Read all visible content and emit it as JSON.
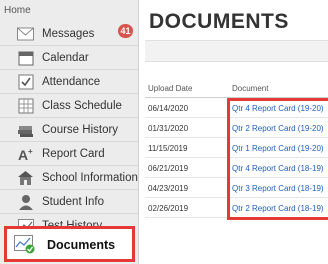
{
  "sidebar": {
    "home": "Home",
    "items": [
      {
        "label": "Messages",
        "icon": "envelope-icon",
        "badge": "41"
      },
      {
        "label": "Calendar",
        "icon": "calendar-icon"
      },
      {
        "label": "Attendance",
        "icon": "checkbox-icon"
      },
      {
        "label": "Class Schedule",
        "icon": "schedule-grid-icon"
      },
      {
        "label": "Course History",
        "icon": "books-icon"
      },
      {
        "label": "Report Card",
        "icon": "grade-a-plus-icon"
      },
      {
        "label": "School Information",
        "icon": "school-building-icon"
      },
      {
        "label": "Student Info",
        "icon": "student-person-icon"
      },
      {
        "label": "Test History",
        "icon": "chart-line-icon"
      }
    ],
    "active": {
      "label": "Documents",
      "icon": "documents-chart-check-icon"
    }
  },
  "main": {
    "title": "DOCUMENTS",
    "columns": {
      "date": "Upload Date",
      "document": "Document"
    },
    "rows": [
      {
        "date": "06/14/2020",
        "document": "Qtr 4 Report Card (19-20)"
      },
      {
        "date": "01/31/2020",
        "document": "Qtr 2 Report Card (19-20)"
      },
      {
        "date": "11/15/2019",
        "document": "Qtr 1 Report Card (19-20)"
      },
      {
        "date": "06/21/2019",
        "document": "Qtr 4 Report Card (18-19)"
      },
      {
        "date": "04/23/2019",
        "document": "Qtr 3 Report Card (18-19)"
      },
      {
        "date": "02/26/2019",
        "document": "Qtr 2 Report Card (18-19)"
      }
    ]
  },
  "colors": {
    "highlight": "#e53935",
    "link": "#1f5fbf",
    "badge": "#d9534f"
  }
}
